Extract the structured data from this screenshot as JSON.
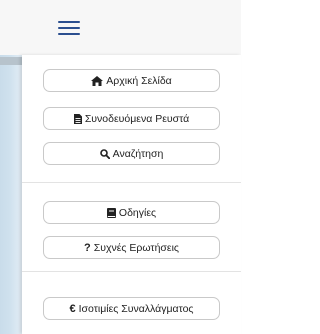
{
  "header": {
    "menu_icon": "hamburger-menu-icon",
    "accent_color": "#2b4f8f"
  },
  "menu": {
    "group1": [
      {
        "label": "Αρχική Σελίδα",
        "icon": "home-icon"
      },
      {
        "label": "Συνοδευόμενα Ρευστά",
        "icon": "file-icon"
      },
      {
        "label": "Αναζήτηση",
        "icon": "search-icon"
      }
    ],
    "group2": [
      {
        "label": "Οδηγίες",
        "icon": "book-icon"
      },
      {
        "label": "Συχνές Ερωτήσεις",
        "icon": "question-icon"
      }
    ],
    "group3": [
      {
        "label": "Ισοτιμίες Συναλλάγματος",
        "icon": "euro-icon"
      }
    ]
  }
}
